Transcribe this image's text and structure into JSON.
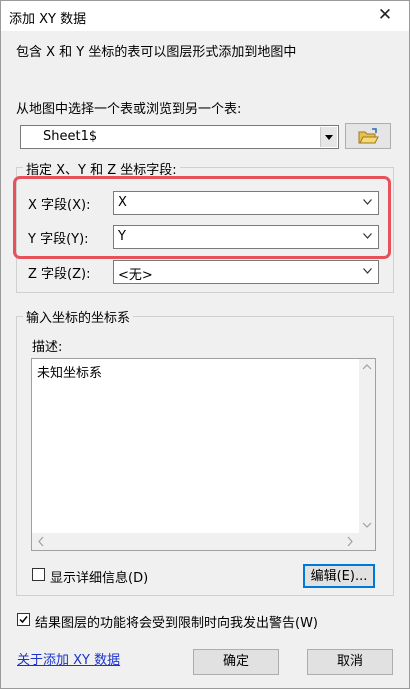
{
  "window": {
    "title": "添加 XY 数据",
    "close_glyph": "✕"
  },
  "intro": "包含 X 和 Y 坐标的表可以图层形式添加到地图中",
  "table_prompt": "从地图中选择一个表或浏览到另一个表:",
  "table_select": {
    "value": "Sheet1$"
  },
  "fields_group": {
    "title": "指定 X、Y 和 Z 坐标字段:",
    "x_label": "X 字段(X):",
    "x_value": "X",
    "y_label": "Y 字段(Y):",
    "y_value": "Y",
    "z_label": "Z 字段(Z):",
    "z_value": "<无>"
  },
  "coord_group": {
    "title": "输入坐标的坐标系",
    "desc_label": "描述:",
    "desc_text": "未知坐标系",
    "show_details_label": "显示详细信息(D)",
    "edit_button": "编辑(E)..."
  },
  "warn_label": "结果图层的功能将会受到限制时向我发出警告(W)",
  "about_link": "关于添加 XY 数据",
  "ok_button": "确定",
  "cancel_button": "取消",
  "colors": {
    "highlight": "#e8505a",
    "link": "#1a33cc",
    "dialog_bg": "#f0f0f0"
  }
}
